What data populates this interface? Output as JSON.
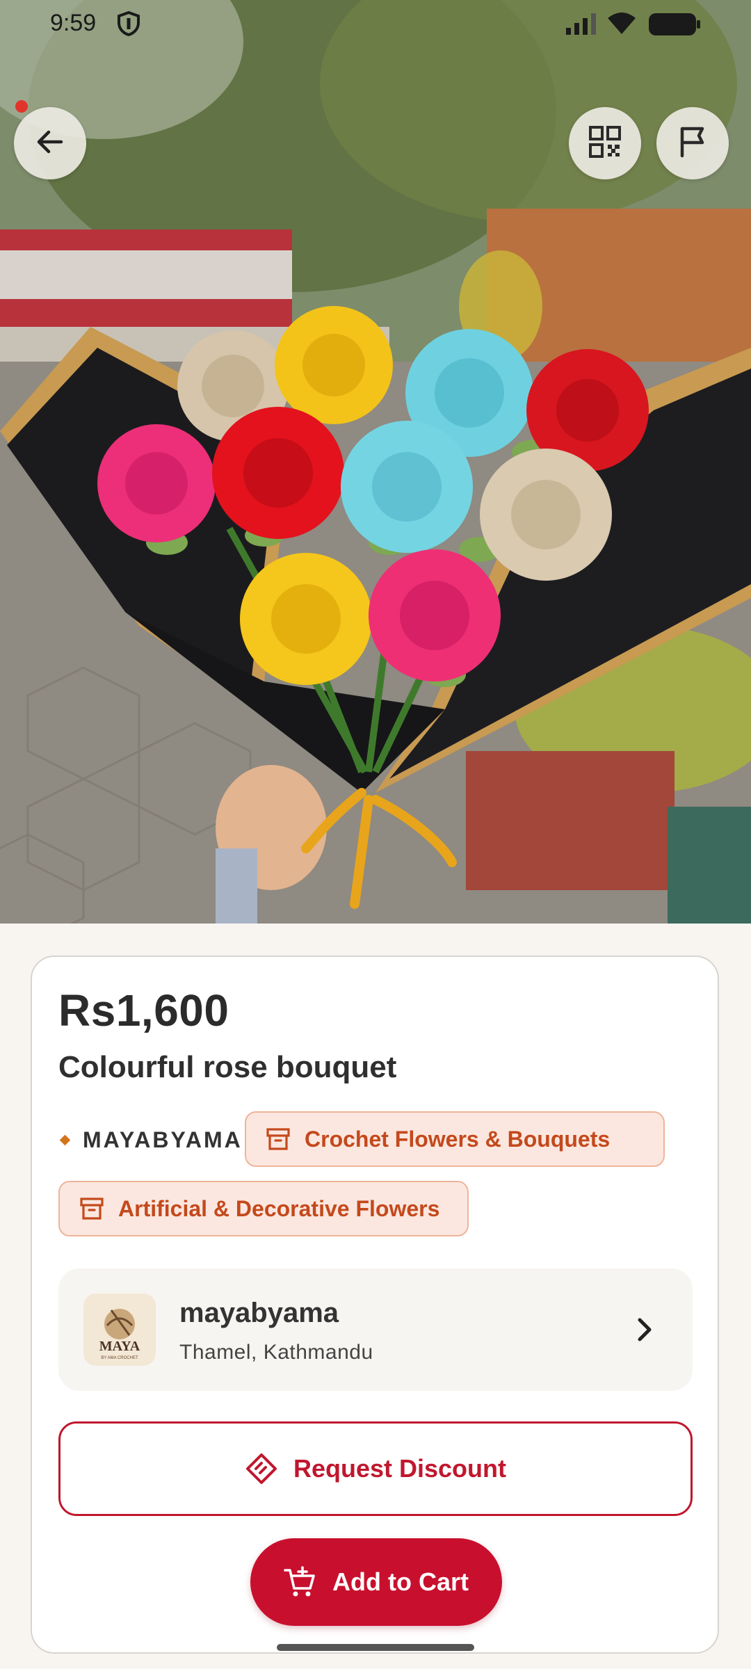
{
  "status_bar": {
    "time": "9:59"
  },
  "hero": {
    "image_icon": "crochet-rose-bouquet-photo"
  },
  "toolbar": {
    "back_icon": "arrow-left-icon",
    "qr_icon": "qr-code-icon",
    "flag_icon": "flag-icon"
  },
  "product": {
    "price": "Rs1,600",
    "title": "Colourful rose bouquet",
    "brand": "MAYABYAMA",
    "categories": [
      {
        "label": "Crochet Flowers & Bouquets",
        "icon": "archive-box-icon"
      },
      {
        "label": "Artificial & Decorative Flowers",
        "icon": "archive-box-icon"
      }
    ]
  },
  "seller": {
    "name": "mayabyama",
    "location": "Thamel, Kathmandu",
    "logo_text": "MAYA",
    "logo_subtext": "BY AMA CROCHET"
  },
  "actions": {
    "request_discount": "Request Discount",
    "add_to_cart": "Add to Cart"
  },
  "colors": {
    "primary": "#c8102e",
    "chip_bg": "#fbe7df",
    "chip_text": "#c4491c",
    "brand_diamond": "#d3741b"
  }
}
